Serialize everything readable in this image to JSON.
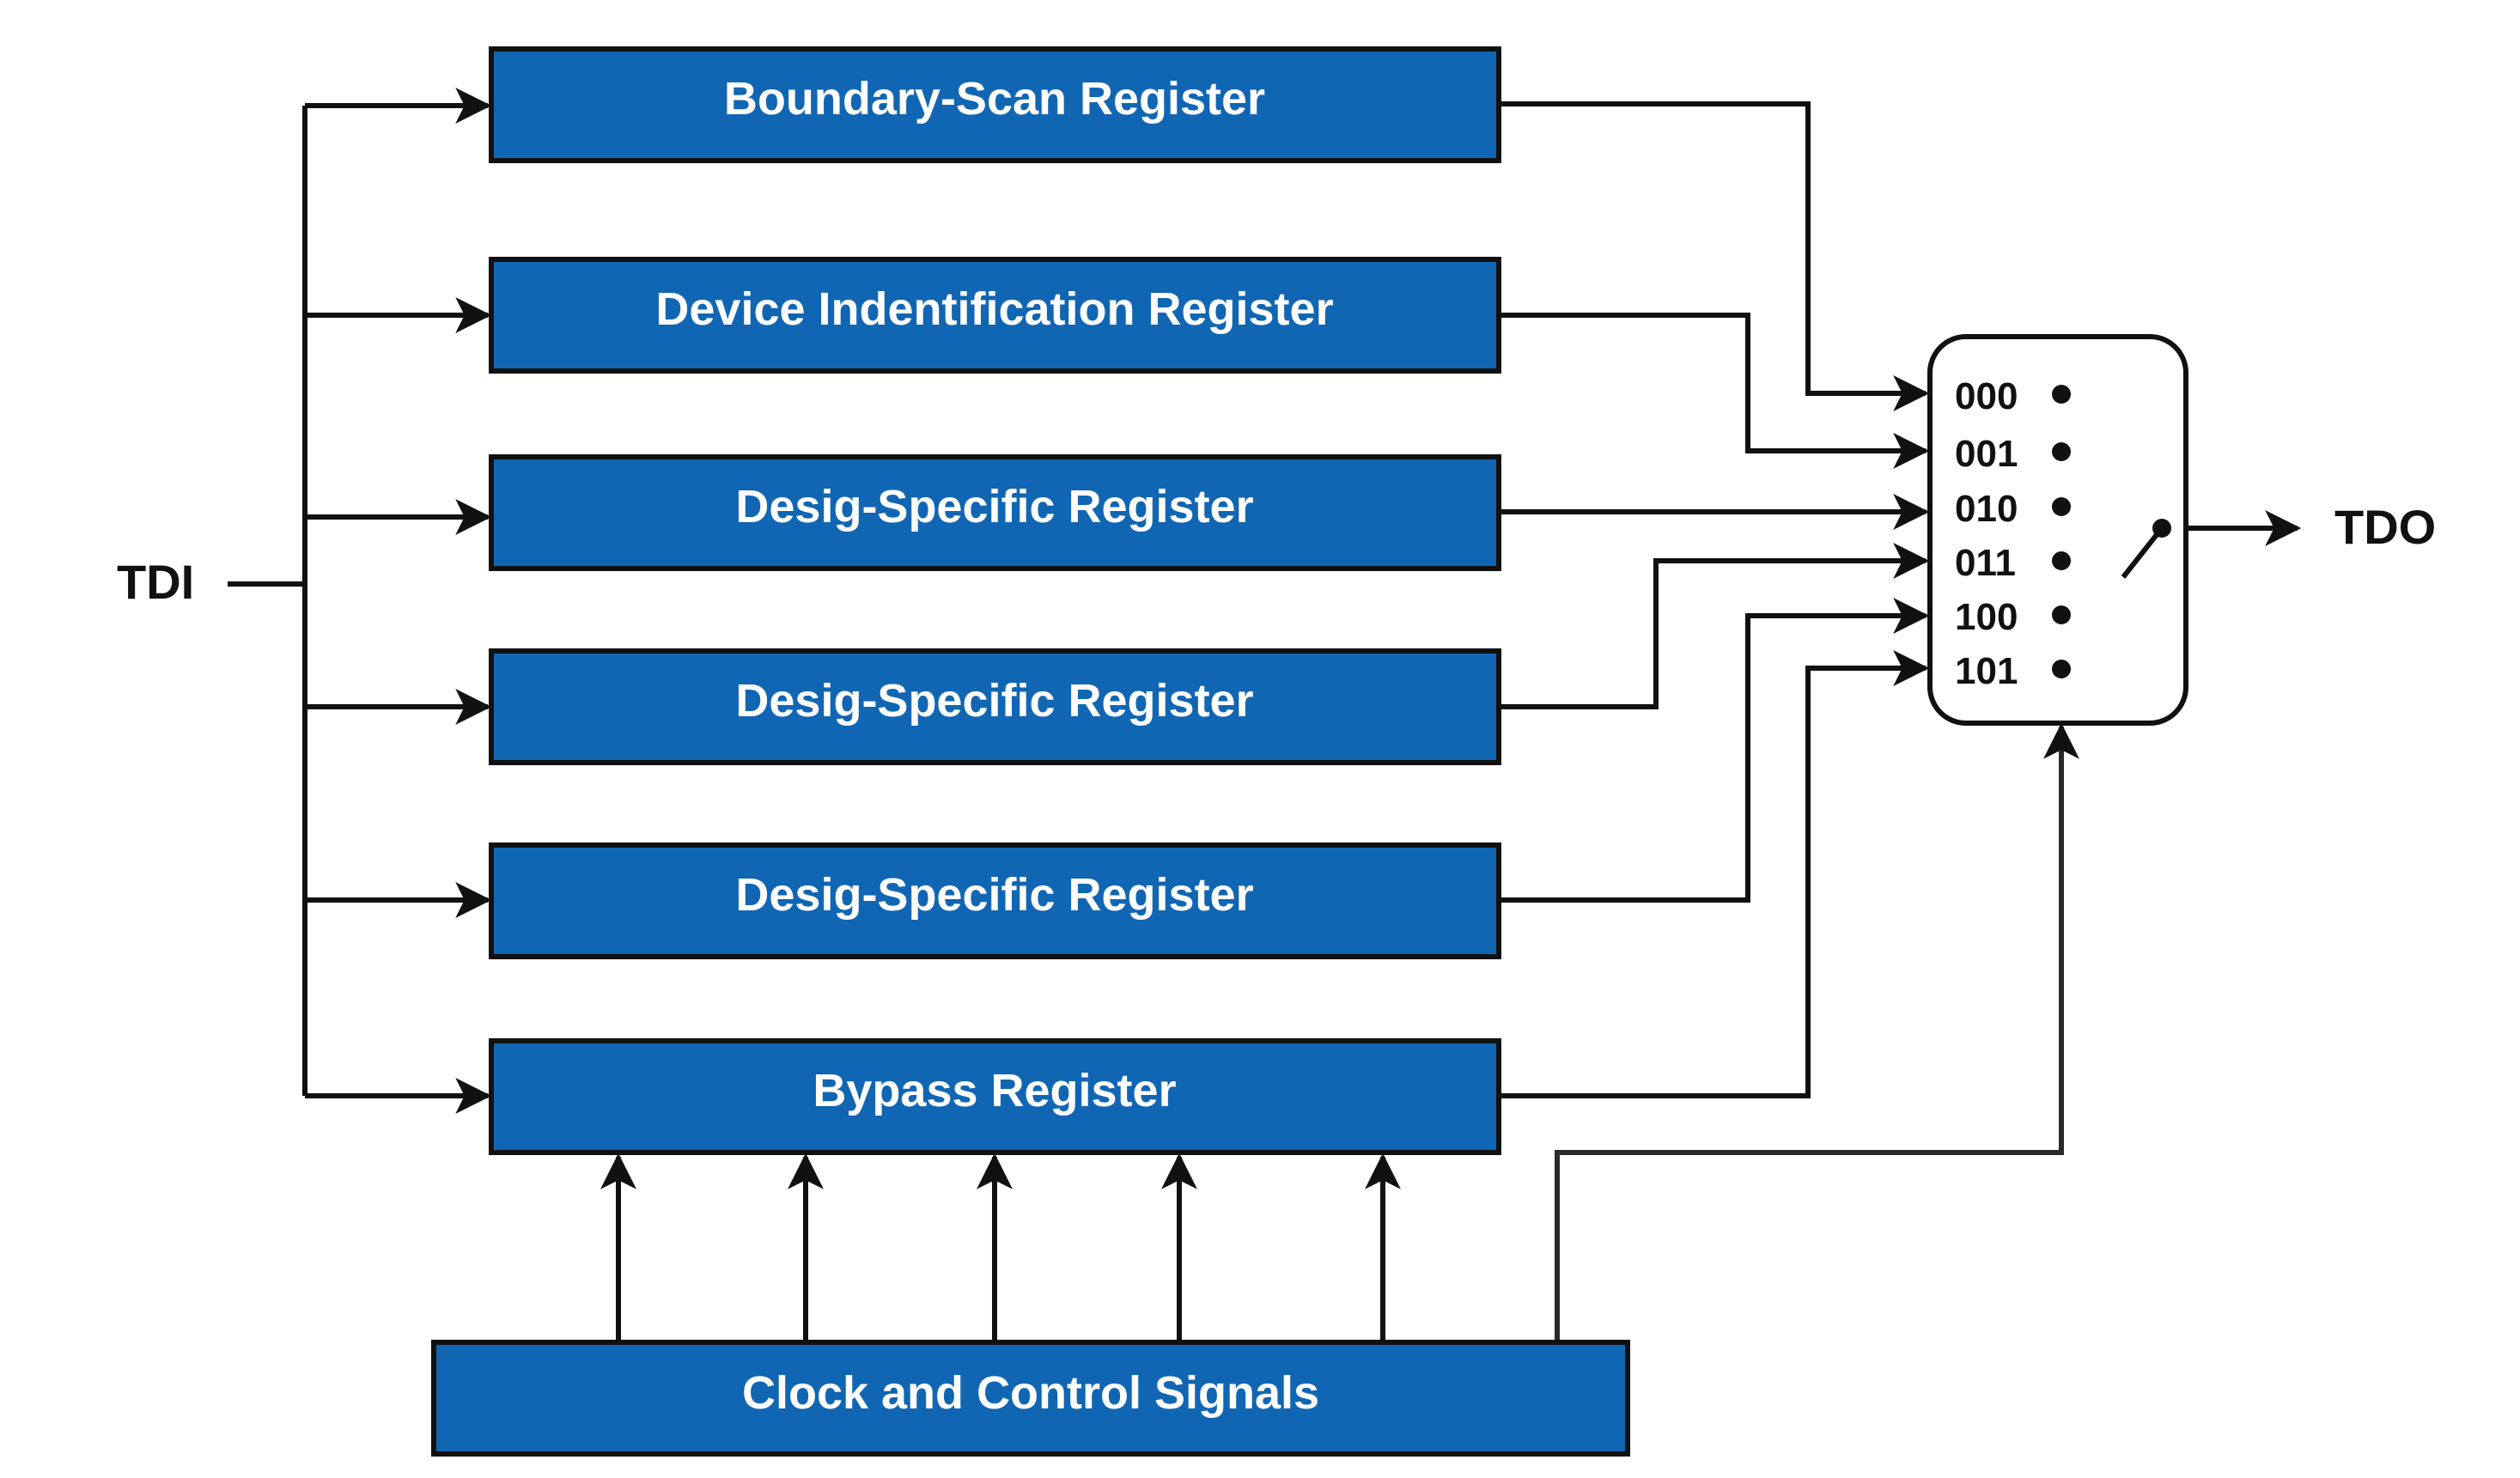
{
  "input_label": "TDI",
  "output_label": "TDO",
  "registers": [
    {
      "label": "Boundary-Scan Register"
    },
    {
      "label": "Device Indentification Register"
    },
    {
      "label": "Desig-Specific Register"
    },
    {
      "label": "Desig-Specific Register"
    },
    {
      "label": "Desig-Specific Register"
    },
    {
      "label": "Bypass Register"
    }
  ],
  "control_block": {
    "label": "Clock and Control Signals"
  },
  "mux": {
    "inputs": [
      "000",
      "001",
      "010",
      "011",
      "100",
      "101"
    ]
  },
  "colors": {
    "register_fill": "#1166b3",
    "line": "#111111",
    "text_on_box": "#ffffff"
  }
}
